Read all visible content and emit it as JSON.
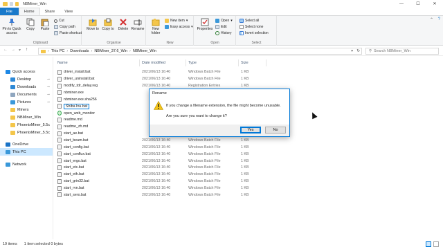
{
  "window": {
    "title": "NBMiner_Win",
    "controls": {
      "minimize": "—",
      "maximize": "☐",
      "close": "✕"
    }
  },
  "tabs": [
    "File",
    "Home",
    "Share",
    "View"
  ],
  "ribbon": {
    "clipboard": {
      "label": "Clipboard",
      "pin": "Pin to Quick access",
      "copy": "Copy",
      "paste": "Paste",
      "cut": "Cut",
      "copy_path": "Copy path",
      "paste_shortcut": "Paste shortcut"
    },
    "organise": {
      "label": "Organise",
      "move_to": "Move to",
      "copy_to": "Copy to",
      "delete": "Delete",
      "rename": "Rename"
    },
    "new": {
      "label": "New",
      "new_folder": "New folder",
      "new_item": "New item",
      "easy_access": "Easy access"
    },
    "open": {
      "label": "Open",
      "properties": "Properties",
      "open": "Open",
      "edit": "Edit",
      "history": "History"
    },
    "select": {
      "label": "Select",
      "select_all": "Select all",
      "select_none": "Select none",
      "invert": "Invert selection"
    }
  },
  "address": {
    "back": "←",
    "forward": "→",
    "up": "↑",
    "path": [
      "This PC",
      "Downloads",
      "NBMiner_37.6_Win",
      "NBMiner_Win"
    ],
    "refresh": "↻",
    "search_placeholder": "Search NBMiner_Win"
  },
  "nav_pane": [
    {
      "label": "Quick access",
      "icon": "star-icon",
      "color": "#1e88e5",
      "indent": 0
    },
    {
      "label": "Desktop",
      "icon": "desktop-icon",
      "color": "#2e89d6",
      "indent": 1,
      "pinned": true
    },
    {
      "label": "Downloads",
      "icon": "download-icon",
      "color": "#2e89d6",
      "indent": 1,
      "pinned": true
    },
    {
      "label": "Documents",
      "icon": "documents-icon",
      "color": "#8fa6bf",
      "indent": 1,
      "pinned": true
    },
    {
      "label": "Pictures",
      "icon": "pictures-icon",
      "color": "#3a98d9",
      "indent": 1,
      "pinned": true
    },
    {
      "label": "Miners",
      "icon": "folder-icon",
      "color": "#f4c64a",
      "indent": 1
    },
    {
      "label": "NBMiner_Win",
      "icon": "folder-icon",
      "color": "#f4c64a",
      "indent": 1
    },
    {
      "label": "PhoenixMiner_5.5c",
      "icon": "folder-icon",
      "color": "#f4c64a",
      "indent": 1
    },
    {
      "label": "PhoenixMiner_5.5c",
      "icon": "folder-icon",
      "color": "#f4c64a",
      "indent": 1
    },
    {
      "label": "OneDrive",
      "icon": "cloud-icon",
      "color": "#1a73c7",
      "indent": 0
    },
    {
      "label": "This PC",
      "icon": "computer-icon",
      "color": "#3a98d9",
      "indent": 0,
      "selected": true
    },
    {
      "label": "Network",
      "icon": "network-icon",
      "color": "#3a98d9",
      "indent": 0
    }
  ],
  "columns": [
    "Name",
    "Date modified",
    "Type",
    "Size"
  ],
  "files": [
    {
      "name": "driver_install.bat",
      "date": "2021/06/13 16:40",
      "type": "Windows Batch File",
      "size": "1 KB"
    },
    {
      "name": "driver_uninstall.bat",
      "date": "2021/06/13 16:40",
      "type": "Windows Batch File",
      "size": "1 KB"
    },
    {
      "name": "modify_tdr_delay.reg",
      "date": "2021/06/13 16:40",
      "type": "Registration Entries",
      "size": "1 KB"
    },
    {
      "name": "nbminer.exe",
      "date": "",
      "type": "",
      "size": ""
    },
    {
      "name": "nbminer.exe.sha256",
      "date": "",
      "type": "",
      "size": ""
    },
    {
      "name": "Shiba Inu.bat",
      "date": "",
      "type": "",
      "size": "",
      "renaming": true
    },
    {
      "name": "open_web_monitor",
      "date": "",
      "type": "",
      "size": "",
      "web": true
    },
    {
      "name": "readme.md",
      "date": "",
      "type": "",
      "size": ""
    },
    {
      "name": "readme_zh.md",
      "date": "",
      "type": "",
      "size": ""
    },
    {
      "name": "start_ae.bat",
      "date": "",
      "type": "",
      "size": ""
    },
    {
      "name": "start_beam.bat",
      "date": "2021/06/13 16:40",
      "type": "Windows Batch File",
      "size": "1 KB"
    },
    {
      "name": "start_config.bat",
      "date": "2021/06/13 16:40",
      "type": "Windows Batch File",
      "size": "1 KB"
    },
    {
      "name": "start_conflux.bat",
      "date": "2021/06/13 16:40",
      "type": "Windows Batch File",
      "size": "1 KB"
    },
    {
      "name": "start_ergo.bat",
      "date": "2021/06/13 16:40",
      "type": "Windows Batch File",
      "size": "1 KB"
    },
    {
      "name": "start_etc.bat",
      "date": "2021/06/13 16:40",
      "type": "Windows Batch File",
      "size": "1 KB"
    },
    {
      "name": "start_eth.bat",
      "date": "2021/06/13 16:40",
      "type": "Windows Batch File",
      "size": "1 KB"
    },
    {
      "name": "start_grin32.bat",
      "date": "2021/06/13 16:40",
      "type": "Windows Batch File",
      "size": "1 KB"
    },
    {
      "name": "start_rvn.bat",
      "date": "2021/06/13 16:40",
      "type": "Windows Batch File",
      "size": "1 KB"
    },
    {
      "name": "start_sero.bat",
      "date": "2021/06/13 16:40",
      "type": "Windows Batch File",
      "size": "1 KB"
    }
  ],
  "status": {
    "count": "19 items",
    "selected": "1 item selected  0 bytes"
  },
  "dialog": {
    "title": "Rename",
    "line1": "If you change a filename extension, the file might become unusable.",
    "line2": "Are you sure you want to change it?",
    "yes": "Yes",
    "no": "No"
  }
}
